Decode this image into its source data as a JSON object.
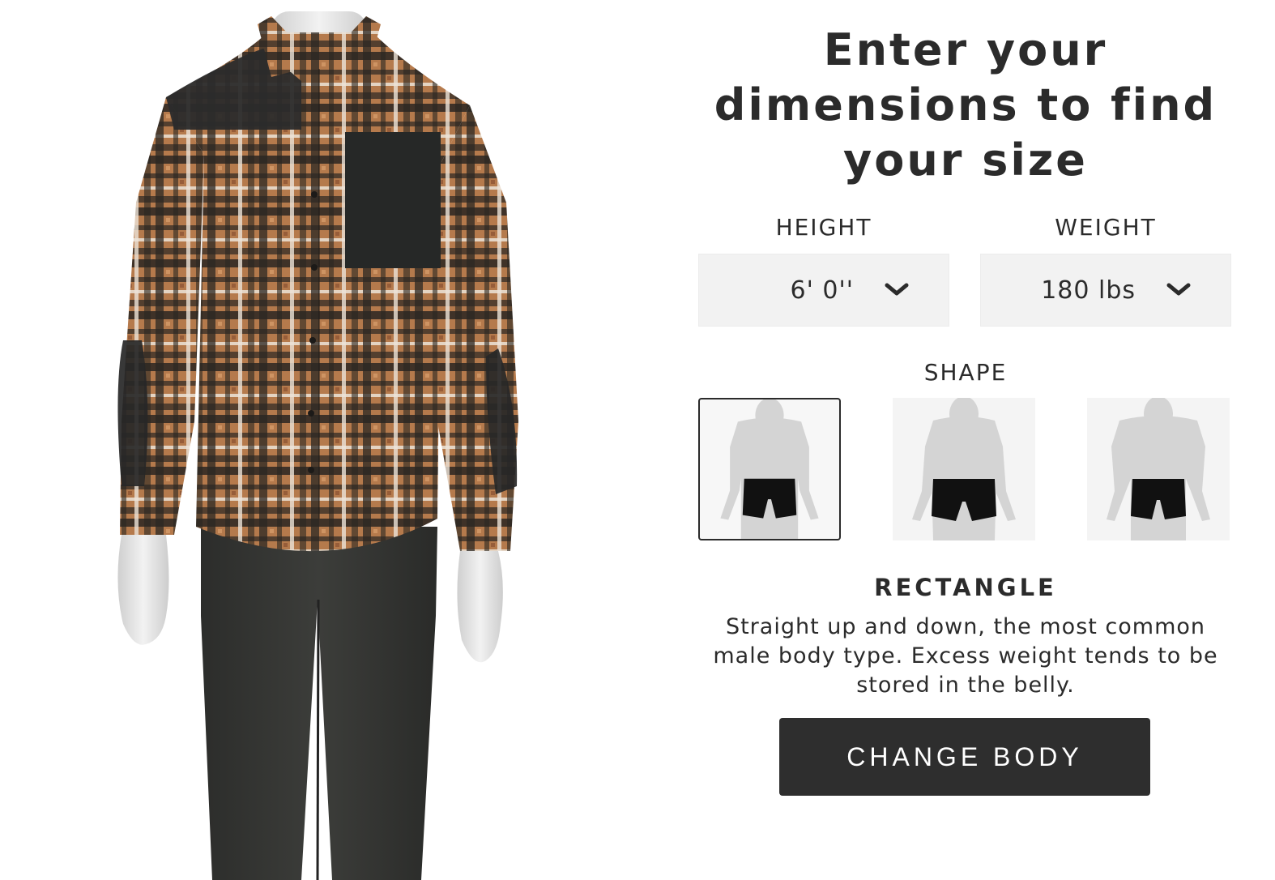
{
  "size_finder": {
    "headline": "Enter your dimensions to find your size",
    "height": {
      "label": "HEIGHT",
      "value": "6' 0''"
    },
    "weight": {
      "label": "WEIGHT",
      "value": "180 lbs"
    },
    "shape": {
      "label": "SHAPE",
      "selected_index": 0,
      "selected_name": "RECTANGLE",
      "description": "Straight up and down, the most common male body type. Excess weight tends to be stored in the belly."
    },
    "change_body_button": "CHANGE BODY"
  },
  "icons": {
    "select_chevron": "chevron-down-icon"
  },
  "colors": {
    "button_bg": "#2e2e2e",
    "select_bg": "#f2f2f2",
    "text": "#2b2b2b",
    "plaid_base": "#b57a4c",
    "plaid_dark": "#2a2622",
    "plaid_light": "#ece4d8",
    "pants": "#343533",
    "mannequin": "#e4e4e4"
  }
}
